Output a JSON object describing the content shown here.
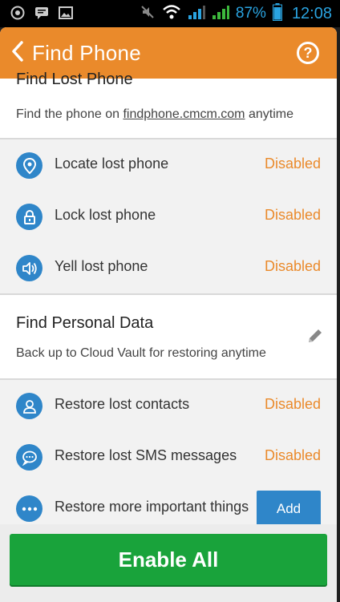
{
  "status_bar": {
    "battery_pct": "87%",
    "time": "12:08"
  },
  "header": {
    "title": "Find Phone"
  },
  "find_lost_phone": {
    "title": "Find Lost Phone",
    "desc_prefix": "Find the phone on ",
    "desc_link": "findphone.cmcm.com",
    "desc_suffix": " anytime",
    "rows": [
      {
        "label": "Locate lost phone",
        "status": "Disabled",
        "icon": "location-pin-icon"
      },
      {
        "label": "Lock lost phone",
        "status": "Disabled",
        "icon": "lock-icon"
      },
      {
        "label": "Yell lost phone",
        "status": "Disabled",
        "icon": "speaker-icon"
      }
    ]
  },
  "find_personal_data": {
    "title": "Find Personal Data",
    "desc": "Back up to Cloud Vault for restoring anytime",
    "rows": [
      {
        "label": "Restore lost contacts",
        "status": "Disabled",
        "icon": "person-icon"
      },
      {
        "label": "Restore lost SMS messages",
        "status": "Disabled",
        "icon": "chat-bubble-icon"
      },
      {
        "label": "Restore more important things",
        "button": "Add",
        "icon": "more-dots-icon"
      }
    ]
  },
  "footer": {
    "enable_all": "Enable All"
  },
  "colors": {
    "accent_orange": "#ea8a2b",
    "icon_blue": "#2f86c9",
    "enable_green": "#19a33b"
  }
}
